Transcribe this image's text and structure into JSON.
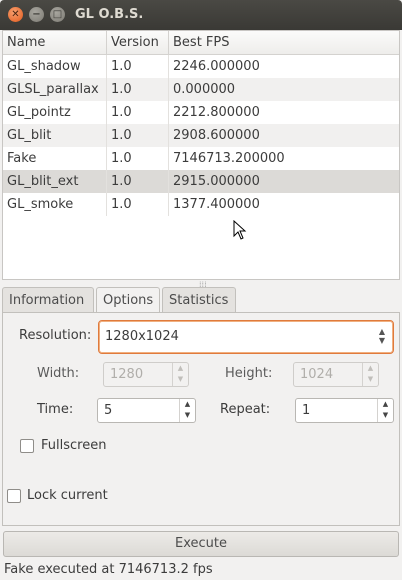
{
  "window": {
    "title": "GL O.B.S.",
    "close_glyph": "✕",
    "min_glyph": "−",
    "max_glyph": "□"
  },
  "table": {
    "headers": [
      "Name",
      "Version",
      "Best FPS"
    ],
    "rows": [
      {
        "name": "GL_shadow",
        "version": "1.0",
        "fps": "2246.000000"
      },
      {
        "name": "GLSL_parallax",
        "version": "1.0",
        "fps": "0.000000"
      },
      {
        "name": "GL_pointz",
        "version": "1.0",
        "fps": "2212.800000"
      },
      {
        "name": "GL_blit",
        "version": "1.0",
        "fps": "2908.600000"
      },
      {
        "name": "Fake",
        "version": "1.0",
        "fps": "7146713.200000"
      },
      {
        "name": "GL_blit_ext",
        "version": "1.0",
        "fps": "2915.000000"
      },
      {
        "name": "GL_smoke",
        "version": "1.0",
        "fps": "1377.400000"
      }
    ]
  },
  "tabs": [
    "Information",
    "Options",
    "Statistics"
  ],
  "options": {
    "resolution_label": "Resolution:",
    "resolution_value": "1280x1024",
    "width_label": "Width:",
    "width_value": "1280",
    "height_label": "Height:",
    "height_value": "1024",
    "time_label": "Time:",
    "time_value": "5",
    "repeat_label": "Repeat:",
    "repeat_value": "1",
    "fullscreen_label": "Fullscreen",
    "lock_label": "Lock current"
  },
  "execute_label": "Execute",
  "status": "Fake executed at 7146713.2 fps",
  "colors": {
    "titlebar": "#3c3b37",
    "accent": "#e07a3c",
    "close": "#e25a1c"
  }
}
